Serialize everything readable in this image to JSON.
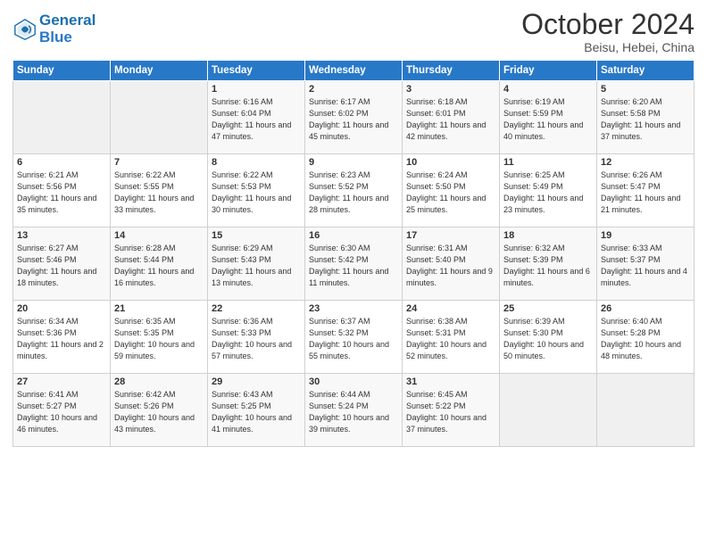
{
  "header": {
    "logo_line1": "General",
    "logo_line2": "Blue",
    "month": "October 2024",
    "location": "Beisu, Hebei, China"
  },
  "weekdays": [
    "Sunday",
    "Monday",
    "Tuesday",
    "Wednesday",
    "Thursday",
    "Friday",
    "Saturday"
  ],
  "weeks": [
    [
      {
        "day": "",
        "content": ""
      },
      {
        "day": "",
        "content": ""
      },
      {
        "day": "1",
        "content": "Sunrise: 6:16 AM\nSunset: 6:04 PM\nDaylight: 11 hours and 47 minutes."
      },
      {
        "day": "2",
        "content": "Sunrise: 6:17 AM\nSunset: 6:02 PM\nDaylight: 11 hours and 45 minutes."
      },
      {
        "day": "3",
        "content": "Sunrise: 6:18 AM\nSunset: 6:01 PM\nDaylight: 11 hours and 42 minutes."
      },
      {
        "day": "4",
        "content": "Sunrise: 6:19 AM\nSunset: 5:59 PM\nDaylight: 11 hours and 40 minutes."
      },
      {
        "day": "5",
        "content": "Sunrise: 6:20 AM\nSunset: 5:58 PM\nDaylight: 11 hours and 37 minutes."
      }
    ],
    [
      {
        "day": "6",
        "content": "Sunrise: 6:21 AM\nSunset: 5:56 PM\nDaylight: 11 hours and 35 minutes."
      },
      {
        "day": "7",
        "content": "Sunrise: 6:22 AM\nSunset: 5:55 PM\nDaylight: 11 hours and 33 minutes."
      },
      {
        "day": "8",
        "content": "Sunrise: 6:22 AM\nSunset: 5:53 PM\nDaylight: 11 hours and 30 minutes."
      },
      {
        "day": "9",
        "content": "Sunrise: 6:23 AM\nSunset: 5:52 PM\nDaylight: 11 hours and 28 minutes."
      },
      {
        "day": "10",
        "content": "Sunrise: 6:24 AM\nSunset: 5:50 PM\nDaylight: 11 hours and 25 minutes."
      },
      {
        "day": "11",
        "content": "Sunrise: 6:25 AM\nSunset: 5:49 PM\nDaylight: 11 hours and 23 minutes."
      },
      {
        "day": "12",
        "content": "Sunrise: 6:26 AM\nSunset: 5:47 PM\nDaylight: 11 hours and 21 minutes."
      }
    ],
    [
      {
        "day": "13",
        "content": "Sunrise: 6:27 AM\nSunset: 5:46 PM\nDaylight: 11 hours and 18 minutes."
      },
      {
        "day": "14",
        "content": "Sunrise: 6:28 AM\nSunset: 5:44 PM\nDaylight: 11 hours and 16 minutes."
      },
      {
        "day": "15",
        "content": "Sunrise: 6:29 AM\nSunset: 5:43 PM\nDaylight: 11 hours and 13 minutes."
      },
      {
        "day": "16",
        "content": "Sunrise: 6:30 AM\nSunset: 5:42 PM\nDaylight: 11 hours and 11 minutes."
      },
      {
        "day": "17",
        "content": "Sunrise: 6:31 AM\nSunset: 5:40 PM\nDaylight: 11 hours and 9 minutes."
      },
      {
        "day": "18",
        "content": "Sunrise: 6:32 AM\nSunset: 5:39 PM\nDaylight: 11 hours and 6 minutes."
      },
      {
        "day": "19",
        "content": "Sunrise: 6:33 AM\nSunset: 5:37 PM\nDaylight: 11 hours and 4 minutes."
      }
    ],
    [
      {
        "day": "20",
        "content": "Sunrise: 6:34 AM\nSunset: 5:36 PM\nDaylight: 11 hours and 2 minutes."
      },
      {
        "day": "21",
        "content": "Sunrise: 6:35 AM\nSunset: 5:35 PM\nDaylight: 10 hours and 59 minutes."
      },
      {
        "day": "22",
        "content": "Sunrise: 6:36 AM\nSunset: 5:33 PM\nDaylight: 10 hours and 57 minutes."
      },
      {
        "day": "23",
        "content": "Sunrise: 6:37 AM\nSunset: 5:32 PM\nDaylight: 10 hours and 55 minutes."
      },
      {
        "day": "24",
        "content": "Sunrise: 6:38 AM\nSunset: 5:31 PM\nDaylight: 10 hours and 52 minutes."
      },
      {
        "day": "25",
        "content": "Sunrise: 6:39 AM\nSunset: 5:30 PM\nDaylight: 10 hours and 50 minutes."
      },
      {
        "day": "26",
        "content": "Sunrise: 6:40 AM\nSunset: 5:28 PM\nDaylight: 10 hours and 48 minutes."
      }
    ],
    [
      {
        "day": "27",
        "content": "Sunrise: 6:41 AM\nSunset: 5:27 PM\nDaylight: 10 hours and 46 minutes."
      },
      {
        "day": "28",
        "content": "Sunrise: 6:42 AM\nSunset: 5:26 PM\nDaylight: 10 hours and 43 minutes."
      },
      {
        "day": "29",
        "content": "Sunrise: 6:43 AM\nSunset: 5:25 PM\nDaylight: 10 hours and 41 minutes."
      },
      {
        "day": "30",
        "content": "Sunrise: 6:44 AM\nSunset: 5:24 PM\nDaylight: 10 hours and 39 minutes."
      },
      {
        "day": "31",
        "content": "Sunrise: 6:45 AM\nSunset: 5:22 PM\nDaylight: 10 hours and 37 minutes."
      },
      {
        "day": "",
        "content": ""
      },
      {
        "day": "",
        "content": ""
      }
    ]
  ]
}
